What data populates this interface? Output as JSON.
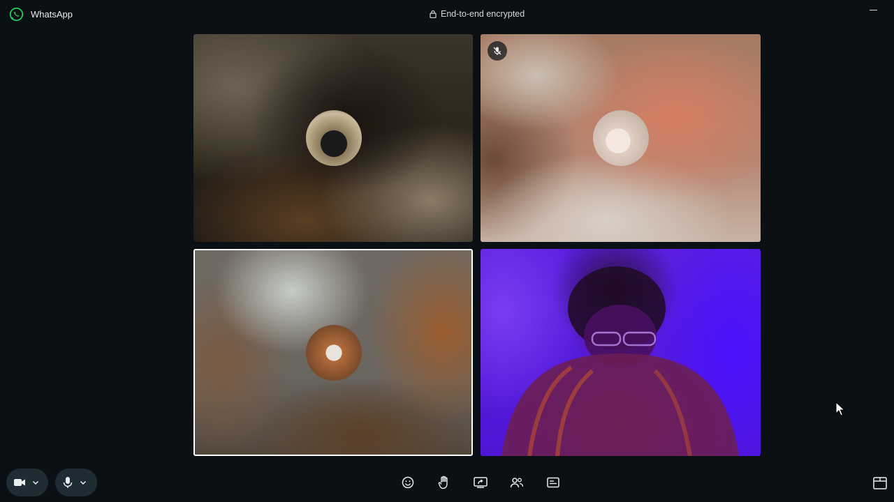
{
  "app": {
    "title": "WhatsApp"
  },
  "header": {
    "encryption_text": "End-to-end encrypted"
  },
  "participants": [
    {
      "muted": false,
      "video_on": false,
      "active": false
    },
    {
      "muted": true,
      "video_on": false,
      "active": false
    },
    {
      "muted": false,
      "video_on": false,
      "active": true
    },
    {
      "muted": false,
      "video_on": true,
      "active": false
    }
  ],
  "controls": {
    "left": [
      "video-camera-icon",
      "chevron-down-icon",
      "microphone-icon",
      "chevron-down-icon"
    ],
    "center": [
      "emoji-icon",
      "raise-hand-icon",
      "screen-share-icon",
      "participants-icon",
      "captions-icon"
    ],
    "right": [
      "layout-icon"
    ]
  },
  "colors": {
    "background": "#0b1014",
    "logo": "#25d366",
    "control_bg": "#202c33",
    "active_border": "#ffffff"
  }
}
